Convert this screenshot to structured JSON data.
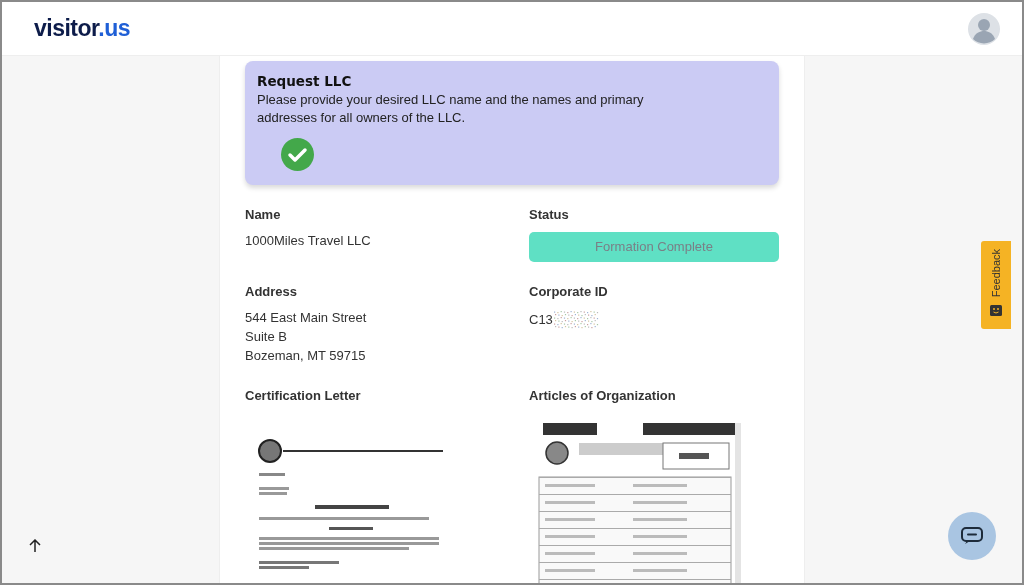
{
  "header": {
    "logo": {
      "main": "visitor",
      "accent": ".us"
    }
  },
  "request": {
    "title": "Request LLC",
    "description": "Please provide your desired LLC name and the names and primary addresses for all owners of the LLC.",
    "completed": true
  },
  "fields": [
    {
      "label": "Name",
      "kind": "text",
      "lines": [
        "1000Miles Travel LLC"
      ]
    },
    {
      "label": "Status",
      "kind": "badge",
      "value": "Formation Complete"
    },
    {
      "label": "Address",
      "kind": "text",
      "lines": [
        "544 East Main Street",
        "Suite B",
        "Bozeman, MT 59715"
      ]
    },
    {
      "label": "Corporate ID",
      "kind": "redacted",
      "value": "C13"
    }
  ],
  "documents": [
    {
      "title": "Certification Letter",
      "kind": "picture"
    },
    {
      "title": "Articles of Organization",
      "kind": "picture"
    }
  ],
  "feedback_tab": {
    "label": "Feedback"
  }
}
